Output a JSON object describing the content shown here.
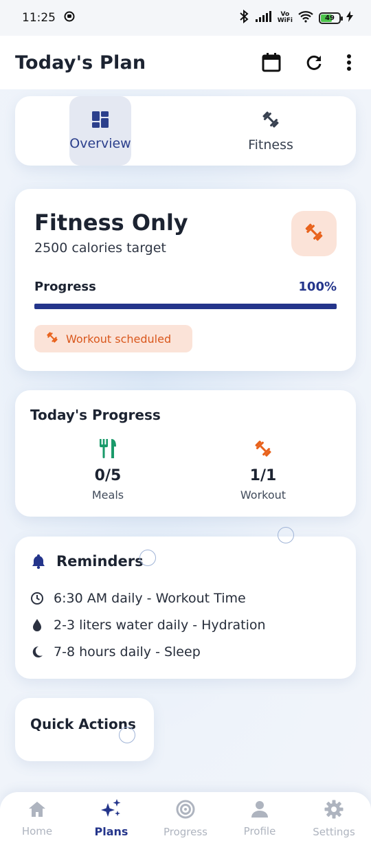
{
  "status": {
    "time": "11:25",
    "battery": "49",
    "vowifi_top": "Vo",
    "vowifi_bottom": "WiFi"
  },
  "appbar": {
    "title": "Today's Plan",
    "icons": [
      "calendar-icon",
      "refresh-icon",
      "more-vert-icon"
    ]
  },
  "tabs": [
    {
      "label": "Overview",
      "icon": "dashboard-icon",
      "active": true
    },
    {
      "label": "Fitness",
      "icon": "dumbbell-icon",
      "active": false
    }
  ],
  "plan": {
    "title": "Fitness Only",
    "subtitle": "2500 calories target",
    "progress_label": "Progress",
    "progress_value": "100%",
    "progress_fraction": 1.0,
    "chip_label": "Workout scheduled",
    "accent": "#e8621c",
    "primary": "#24358b"
  },
  "today": {
    "title": "Today's Progress",
    "stats": [
      {
        "value": "0/5",
        "label": "Meals",
        "icon": "utensils-icon",
        "color": "#1a9a6a"
      },
      {
        "value": "1/1",
        "label": "Workout",
        "icon": "dumbbell-icon",
        "color": "#e8621c"
      }
    ]
  },
  "reminders": {
    "title": "Reminders",
    "items": [
      {
        "icon": "clock-icon",
        "text": "6:30 AM daily - Workout Time"
      },
      {
        "icon": "water-drop-icon",
        "text": "2-3 liters water daily - Hydration"
      },
      {
        "icon": "moon-icon",
        "text": "7-8 hours daily - Sleep"
      }
    ]
  },
  "quick_actions": {
    "title": "Quick Actions"
  },
  "nav": [
    {
      "label": "Home",
      "icon": "home-icon",
      "active": false
    },
    {
      "label": "Plans",
      "icon": "sparkles-icon",
      "active": true
    },
    {
      "label": "Progress",
      "icon": "target-icon",
      "active": false
    },
    {
      "label": "Profile",
      "icon": "person-icon",
      "active": false
    },
    {
      "label": "Settings",
      "icon": "gear-icon",
      "active": false
    }
  ]
}
